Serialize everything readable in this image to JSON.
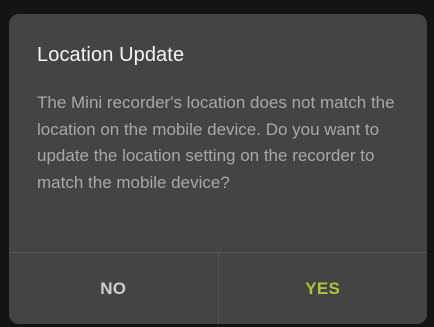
{
  "dialog": {
    "title": "Location Update",
    "message": "The Mini recorder's location does not match the location on the mobile device. Do you want to update the location setting on the recorder to match the mobile device?",
    "no_label": "NO",
    "yes_label": "YES"
  },
  "colors": {
    "overlay": "#141414",
    "dialog_bg": "#444444",
    "title": "#f5f5f5",
    "message": "#a8a8a8",
    "no_button": "#cfcfcf",
    "yes_button": "#a6c83a",
    "divider": "#555555"
  }
}
